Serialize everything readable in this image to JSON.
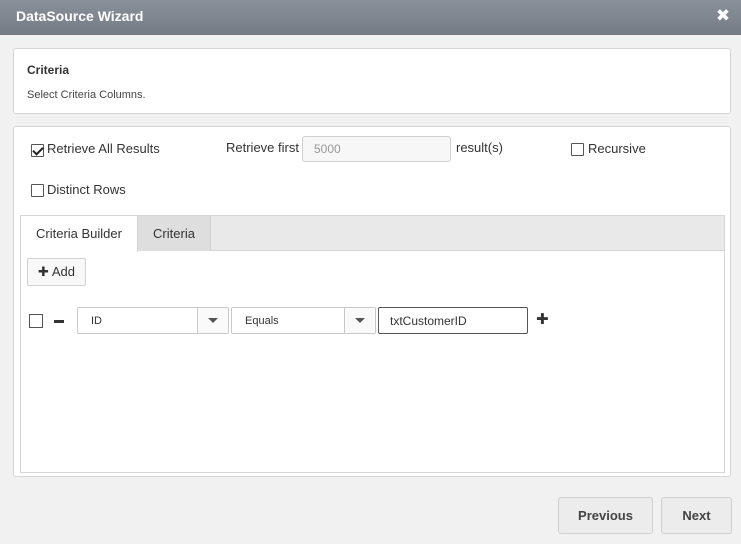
{
  "window": {
    "title": "DataSource Wizard",
    "close_glyph": "✖"
  },
  "header": {
    "title": "Criteria",
    "subtitle": "Select Criteria Columns."
  },
  "options": {
    "retrieve_all_label": "Retrieve All Results",
    "retrieve_all_checked": true,
    "retrieve_first_label": "Retrieve first",
    "retrieve_first_value": "5000",
    "results_suffix": "result(s)",
    "recursive_label": "Recursive",
    "recursive_checked": false,
    "distinct_rows_label": "Distinct Rows",
    "distinct_rows_checked": false
  },
  "tabs": [
    {
      "label": "Criteria Builder",
      "active": true
    },
    {
      "label": "Criteria",
      "active": false
    }
  ],
  "builder": {
    "add_label": "Add",
    "rows": [
      {
        "checked": false,
        "field": "ID",
        "operator": "Equals",
        "value": "txtCustomerID"
      }
    ]
  },
  "footer": {
    "previous_label": "Previous",
    "next_label": "Next"
  },
  "icons": {
    "close": "close-icon",
    "add": "plus-icon",
    "remove_row": "minus-icon",
    "dropdown": "chevron-down-icon",
    "add_row": "plus-icon"
  },
  "colors": {
    "titlebar": "#7f858f",
    "panel_border": "#d5d5d5",
    "tabbar": "#e9e9e9"
  }
}
